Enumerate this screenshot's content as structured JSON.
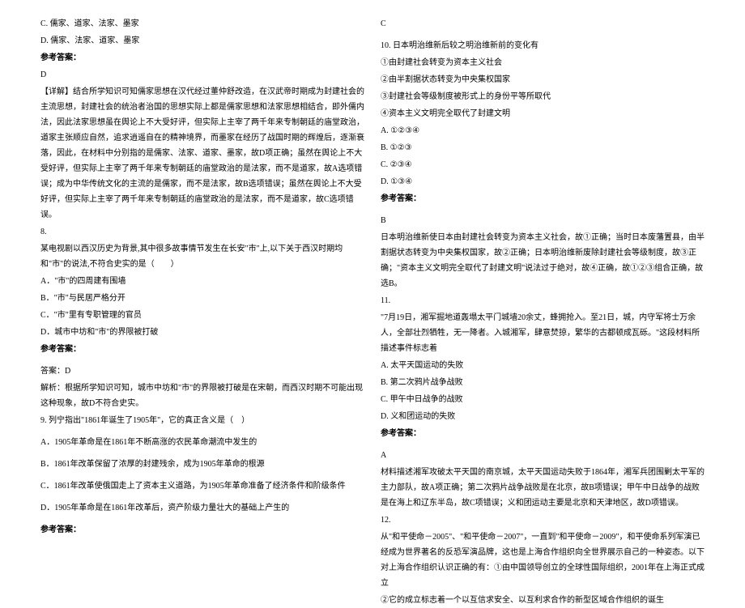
{
  "left": {
    "optC": "C. 儒家、道家、法家、墨家",
    "optD": "D. 儒家、法家、道家、墨家",
    "ansLabel1": "参考答案：",
    "ans1": "D",
    "explain1": "【详解】结合所学知识可知儒家思想在汉代经过董仲舒改造，在汉武帝时期成为封建社会的主流思想，封建社会的统治者治国的思想实际上都是儒家思想和法家思想相结合，即外儒内法，因此法家思想虽在舆论上不大受好评，但实际上主宰了两千年来专制朝廷的庙堂政治，道家主张顺应自然，追求逍遥自在的精神境界，而墨家在经历了战国时期的辉煌后，逐渐衰落，因此，在材料中分别指的是儒家、法家、道家、墨家，故D项正确；虽然在舆论上不大受好评，但实际上主宰了两千年来专制朝廷的庙堂政治的是法家，而不是道家，故A选项错误；成为中华传统文化的主流的是儒家，而不是法家，故B选项错误；虽然在舆论上不大受好评，但实际上主宰了两千年来专制朝廷的庙堂政治的是法家，而不是道家，故C选项错误。",
    "q8num": "8.",
    "q8text": "某电视剧以西汉历史为背景,其中很多故事情节发生在长安\"市\"上,以下关于西汉时期均和\"市\"的说法,不符合史实的是（　　）",
    "q8a": "A．\"市\"的四周建有围墙",
    "q8b": "B．\"市\"与民居严格分开",
    "q8c": "C．\"市\"里有专职管理的官员",
    "q8d": "D．城市中坊和\"市\"的界限被打破",
    "ansLabel2": "参考答案：",
    "ans2line1": "答案：D",
    "ans2line2": "解析：根据所学知识可知，城市中坊和\"市\"的界限被打破是在宋朝，而西汉时期不可能出现这种现象，故D不符合史实。",
    "q9": "9. 列宁指出\"1861年诞生了1905年\"，它的真正含义是（　）",
    "q9a": "A．1905年革命是在1861年不断高涨的农民革命潮流中发生的",
    "q9b": "B．1861年改革保留了浓厚的封建残余，成为1905年革命的根源",
    "q9c": "C．1861年改革使俄国走上了资本主义道路，为1905年革命准备了经济条件和阶级条件",
    "q9d": "D．1905年革命是在1861年改革后，资产阶级力量壮大的基础上产生的",
    "ansLabel3": "参考答案："
  },
  "right": {
    "ansC": "C",
    "q10": "10. 日本明治维新后较之明治维新前的变化有",
    "q10_1": "①由封建社会转变为资本主义社会",
    "q10_2": "②由半割据状态转变为中央集权国家",
    "q10_3": "③封建社会等级制度被形式上的身份平等所取代",
    "q10_4": "④资本主义文明完全取代了封建文明",
    "q10a": "A. ①②③④",
    "q10b": "B. ①②③",
    "q10c": "C. ②③④",
    "q10d": "D. ①③④",
    "ansLabel4": "参考答案：",
    "ans4": "B",
    "explain4": "日本明治维新使日本由封建社会转变为资本主义社会，故①正确；当时日本废藩置县，由半割据状态转变为中央集权国家，故②正确；日本明治维新废除封建社会等级制度，故③正确；\"资本主义文明完全取代了封建文明\"说法过于绝对，故④正确，故①②③组合正确，故选B。",
    "q11num": "11.",
    "q11text": "\"7月19日，湘军掘地道轰塌太平门城墙20余丈，蜂拥抢入。至21日，城，内守军将士万余人，全部壮烈牺牲，无一降者。入城湘军，肆意焚掠，繁华的古都顿成瓦砾。\"这段材料所描述事件标志着",
    "q11a": "A. 太平天国运动的失败",
    "q11b": "B. 第二次鸦片战争战败",
    "q11c": "C. 甲午中日战争的战败",
    "q11d": "D. 义和团运动的失败",
    "ansLabel5": "参考答案：",
    "ans5": "A",
    "explain5": "材料描述湘军攻破太平天国的南京城，太平天国运动失败于1864年，湘军兵团围剿太平军的主力部队，故A项正确；第二次鸦片战争战败是在北京，故B项错误；甲午中日战争的战败是在海上和辽东半岛，故C项错误；义和团运动主要是北京和天津地区，故D项错误。",
    "q12num": "12.",
    "q12text": "从\"和平使命－2005\"、\"和平使命－2007\"，一直到\"和平使命－2009\"，和平使命系列军演已经成为世界著名的反恐军演品牌，这也是上海合作组织向全世界展示自己的一种姿态。以下对上海合作组织认识正确的有：①由中国领导创立的全球性国际组织，2001年在上海正式成立",
    "q12_2": "②它的成立标志着一个以互信求安全、以互利求合作的新型区域合作组织的诞生"
  }
}
